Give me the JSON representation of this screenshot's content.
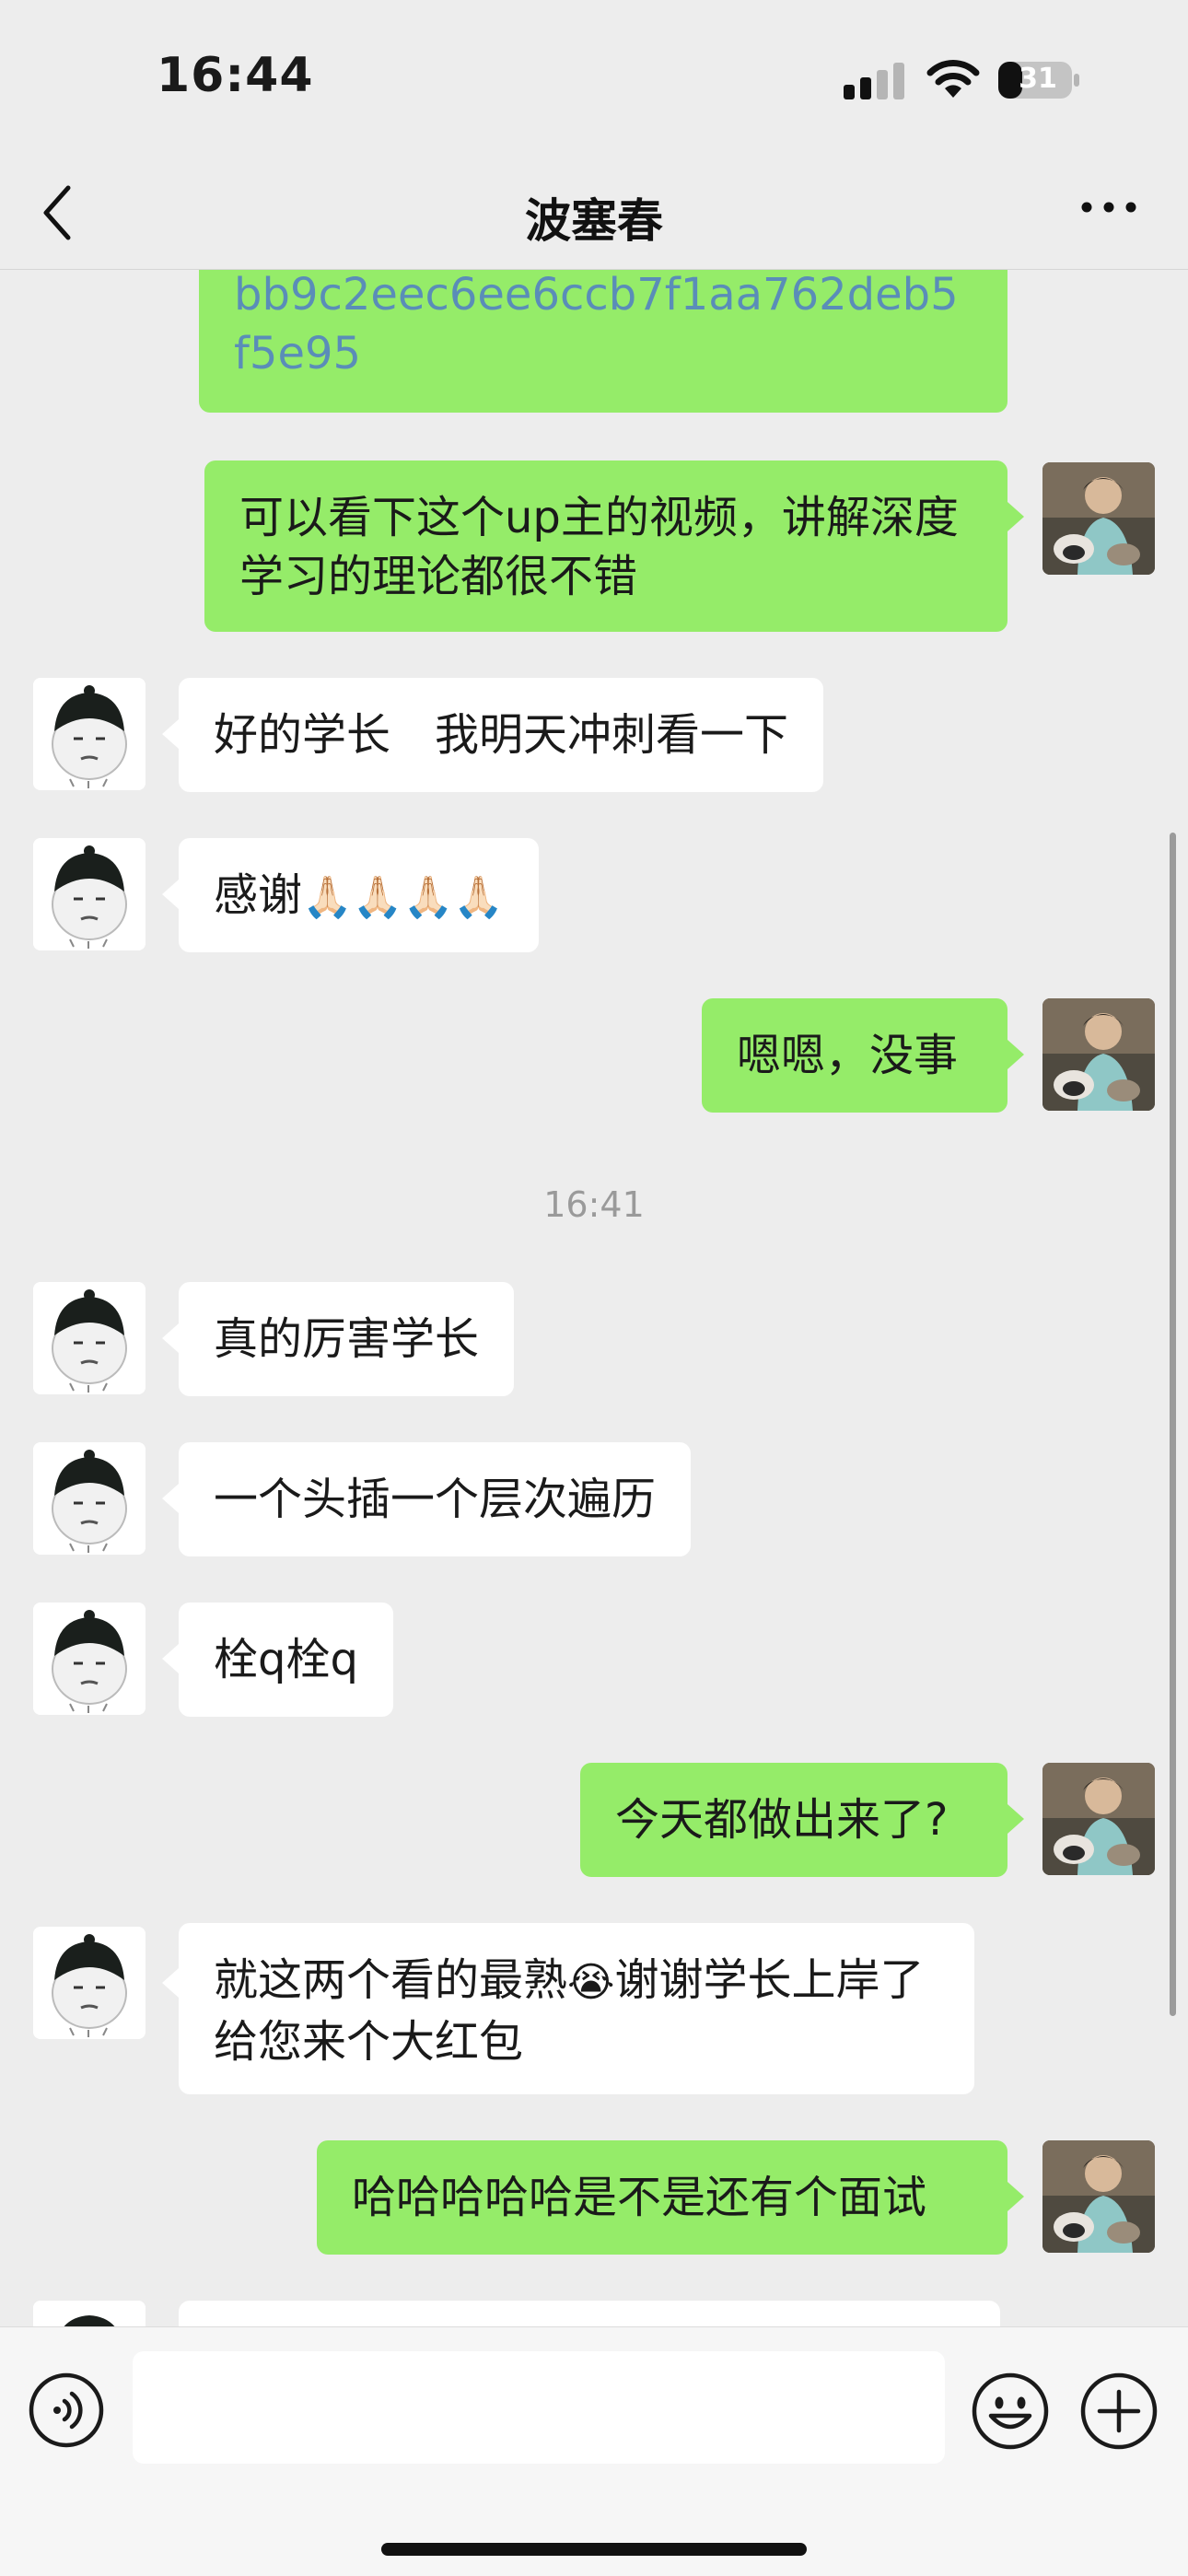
{
  "status": {
    "time": "16:44",
    "battery": "31"
  },
  "header": {
    "title": "波塞春"
  },
  "messages": {
    "m0": "bb9c2eec6ee6ccb7f1aa762deb5f5e95",
    "m1": "可以看下这个up主的视频，讲解深度学习的理论都很不错",
    "m2": "好的学长　我明天冲刺看一下",
    "m3": "感谢",
    "m3_emoji": "🙏🏻🙏🏻🙏🏻🙏🏻",
    "m4": "嗯嗯，没事",
    "ts": "16:41",
    "m5": "真的厉害学长",
    "m6": "一个头插一个层次遍历",
    "m7": "栓q栓q",
    "m8": "今天都做出来了?",
    "m9a": "就这两个看的最熟",
    "m9_emoji": "😭",
    "m9b": "谢谢学长上岸了给您来个大红包",
    "m10": "哈哈哈哈哈是不是还有个面试"
  },
  "colors": {
    "outgoing_bubble": "#95ec69",
    "incoming_bubble": "#ffffff",
    "background": "#ededed",
    "link": "#5a8db8"
  },
  "icons": {
    "back": "chevron-left-icon",
    "more": "more-dots-icon",
    "voice": "voice-icon",
    "emoji": "emoji-icon",
    "plus": "plus-icon",
    "signal": "signal-icon",
    "wifi": "wifi-icon",
    "battery": "battery-icon"
  }
}
